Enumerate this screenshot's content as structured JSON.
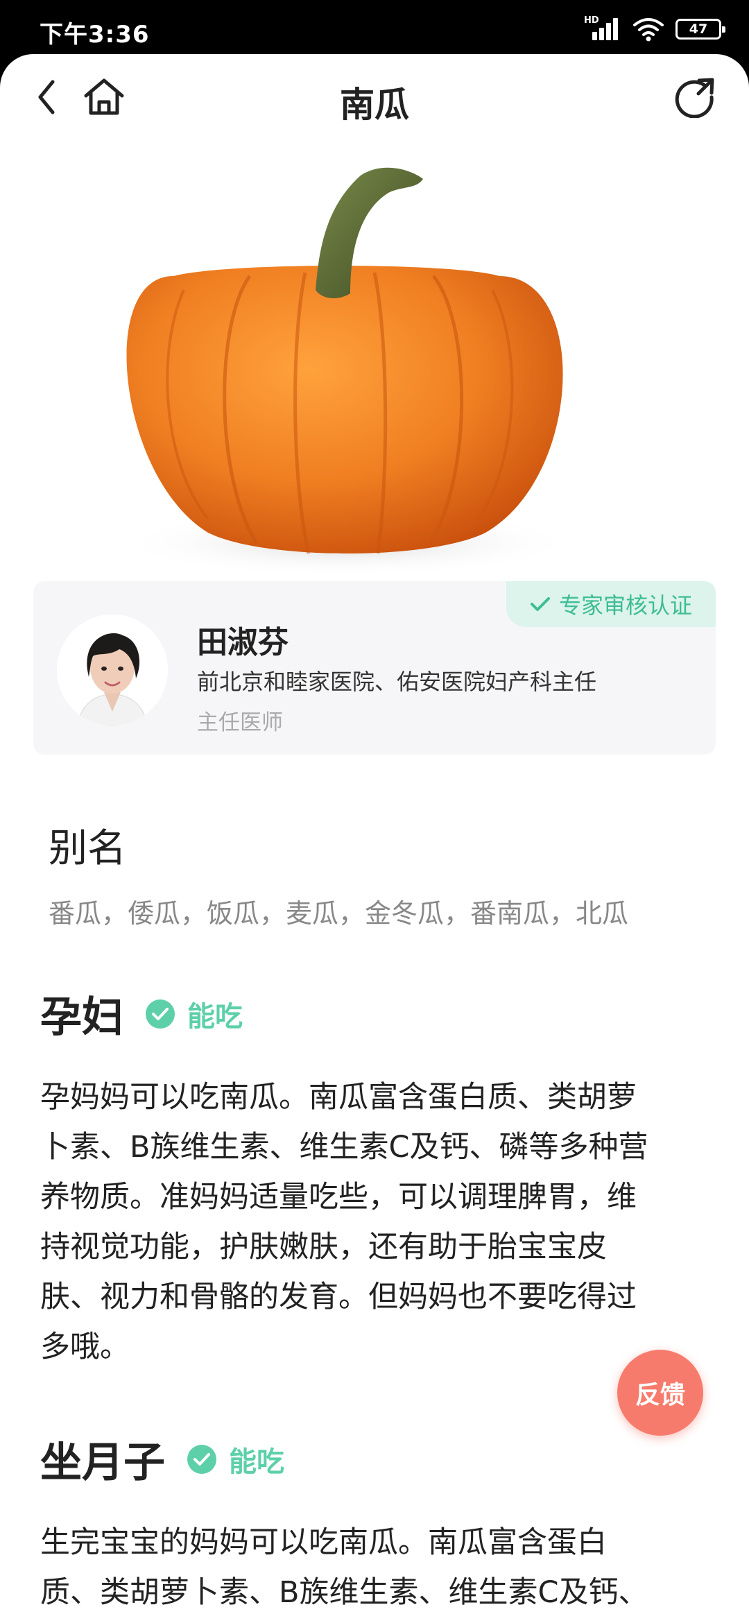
{
  "status_bar": {
    "time": "下午3:36",
    "network_label": "HD",
    "battery_level": "47"
  },
  "nav": {
    "title": "南瓜"
  },
  "expert": {
    "badge": "专家审核认证",
    "name": "田淑芬",
    "title": "前北京和睦家医院、佑安医院妇产科主任",
    "rank": "主任医师"
  },
  "alias": {
    "heading": "别名",
    "text": "番瓜，倭瓜，饭瓜，麦瓜，金冬瓜，番南瓜，北瓜"
  },
  "sections": [
    {
      "title": "孕妇",
      "status": "能吃",
      "lines": [
        "孕妈妈可以吃南瓜。南瓜富含蛋白质、类胡萝",
        "卜素、B族维生素、维生素C及钙、磷等多种营",
        "养物质。准妈妈适量吃些，可以调理脾胃，维",
        "持视觉功能，护肤嫩肤，还有助于胎宝宝皮",
        "肤、视力和骨骼的发育。但妈妈也不要吃得过",
        "多哦。"
      ]
    },
    {
      "title": "坐月子",
      "status": "能吃",
      "lines": [
        "生完宝宝的妈妈可以吃南瓜。南瓜富含蛋白",
        "质、类胡萝卜素、B族维生素、维生素C及钙、"
      ]
    }
  ],
  "feedback_label": "反馈",
  "colors": {
    "accent_green": "#5dd0a9",
    "badge_bg": "#dcf4ec",
    "feedback": "#f77b6c",
    "pumpkin": "#f07f22"
  },
  "icons": [
    "back-icon",
    "home-icon",
    "share-icon",
    "check-icon",
    "check-circle-icon",
    "wifi-icon",
    "signal-icon",
    "battery-icon"
  ]
}
